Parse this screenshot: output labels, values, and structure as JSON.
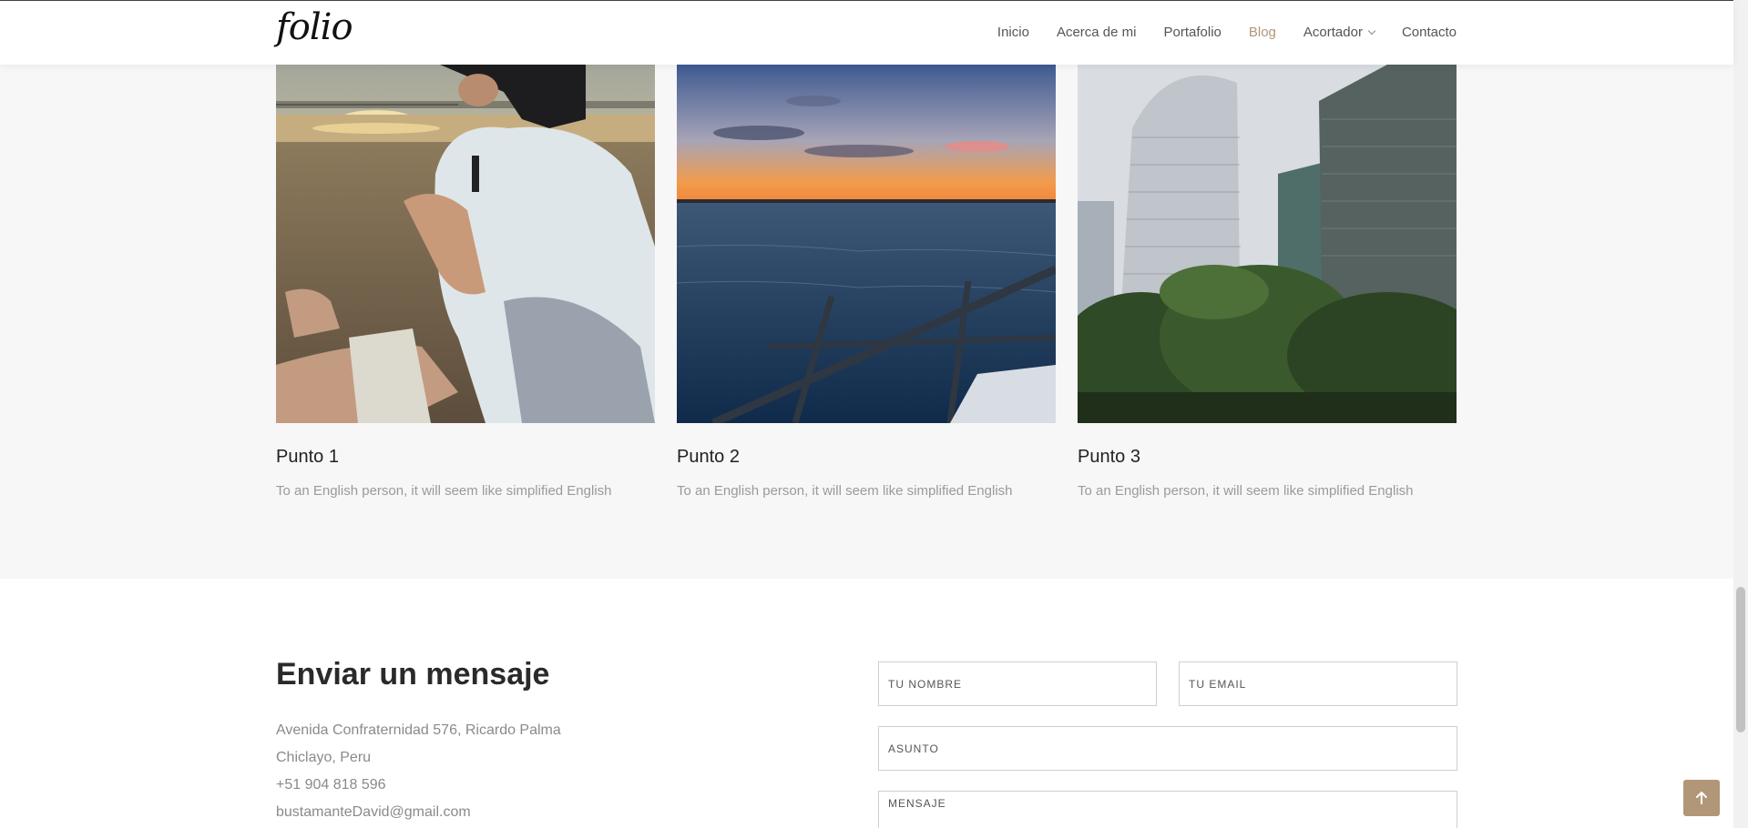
{
  "header": {
    "logo": "folio",
    "nav": [
      {
        "label": "Inicio"
      },
      {
        "label": "Acerca de mi"
      },
      {
        "label": "Portafolio"
      },
      {
        "label": "Blog",
        "active": true
      },
      {
        "label": "Acortador",
        "dropdown": true
      },
      {
        "label": "Contacto"
      }
    ]
  },
  "gallery": {
    "cards": [
      {
        "title": "Punto 1",
        "description": "To an English person, it will seem like simplified English",
        "image": "beach-photographer-photo"
      },
      {
        "title": "Punto 2",
        "description": "To an English person, it will seem like simplified English",
        "image": "sunset-sea-photo"
      },
      {
        "title": "Punto 3",
        "description": "To an English person, it will seem like simplified English",
        "image": "skyscrapers-photo"
      }
    ]
  },
  "contact": {
    "title": "Enviar un mensaje",
    "address_line1": "Avenida Confraternidad 576, Ricardo Palma",
    "address_line2": "Chiclayo, Peru",
    "phone": "+51 904 818 596",
    "email": "bustamanteDavid@gmail.com",
    "form": {
      "name_placeholder": "TU NOMBRE",
      "email_placeholder": "TU EMAIL",
      "subject_placeholder": "ASUNTO",
      "message_placeholder": "MENSAJE"
    }
  },
  "colors": {
    "accent": "#b19777",
    "section_bg": "#f7f7f7"
  },
  "icons": {
    "back_to_top": "arrow-up-icon",
    "dropdown": "chevron-down-icon"
  }
}
